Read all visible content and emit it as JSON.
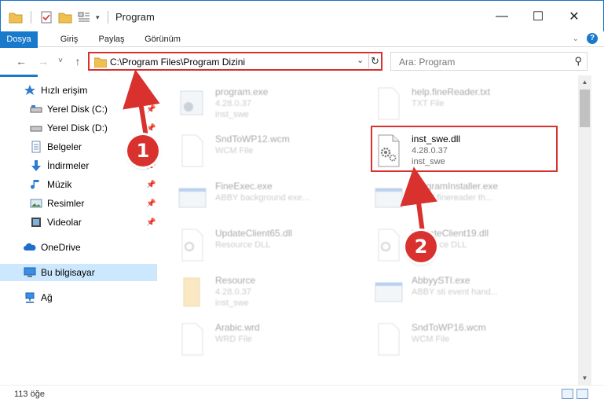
{
  "window": {
    "title": "Program",
    "controls": {
      "minimize": "—",
      "maximize": "☐",
      "close": "✕"
    }
  },
  "ribbon": {
    "tabs": [
      {
        "label": "Dosya"
      },
      {
        "label": "Giriş"
      },
      {
        "label": "Paylaş"
      },
      {
        "label": "Görünüm"
      }
    ],
    "help_label": "?"
  },
  "nav": {
    "back": "←",
    "forward": "→",
    "recent": "˅",
    "up": "↑",
    "address_path": "C:\\Program Files\\Program Dizini",
    "refresh": "↻",
    "search_placeholder": "Ara: Program"
  },
  "sidebar": {
    "items": [
      {
        "label": "Hızlı erişim",
        "icon": "star-icon"
      },
      {
        "label": "Yerel Disk (C:)",
        "icon": "drive-icon",
        "pinned": true
      },
      {
        "label": "Yerel Disk (D:)",
        "icon": "drive-icon",
        "pinned": true
      },
      {
        "label": "Belgeler",
        "icon": "documents-icon",
        "pinned": true
      },
      {
        "label": "İndirmeler",
        "icon": "download-icon",
        "pinned": true
      },
      {
        "label": "Müzik",
        "icon": "music-icon",
        "pinned": true
      },
      {
        "label": "Resimler",
        "icon": "pictures-icon",
        "pinned": true
      },
      {
        "label": "Videolar",
        "icon": "videos-icon",
        "pinned": true
      },
      {
        "label": "OneDrive",
        "icon": "cloud-icon"
      },
      {
        "label": "Bu bilgisayar",
        "icon": "computer-icon",
        "selected": true
      },
      {
        "label": "Ağ",
        "icon": "network-icon"
      }
    ]
  },
  "files": [
    {
      "name": "program.exe",
      "line2": "4.28.0.37",
      "line3": "inst_swe",
      "icon": "exe-icon"
    },
    {
      "name": "help.fineReader.txt",
      "line2": "TXT File",
      "line3": "",
      "icon": "text-file-icon"
    },
    {
      "name": "SndToWP12.wcm",
      "line2": "WCM File",
      "line3": "",
      "icon": "generic-file-icon"
    },
    {
      "name": "inst_swe.dll",
      "line2": "4.28.0.37",
      "line3": "inst_swe",
      "icon": "dll-gear-icon",
      "highlighted": true
    },
    {
      "name": "FineExec.exe",
      "line2": "ABBY background exe...",
      "line3": "",
      "icon": "app-window-icon"
    },
    {
      "name": "ProgramInstaller.exe",
      "line2": "ABBY finereader th...",
      "line3": "",
      "icon": "app-window-icon"
    },
    {
      "name": "UpdateClient65.dll",
      "line2": "Resource DLL",
      "line3": "",
      "icon": "dll-gear-icon"
    },
    {
      "name": "UpdateClient19.dll",
      "line2": "Resource DLL",
      "line3": "",
      "icon": "dll-gear-icon"
    },
    {
      "name": "Resource",
      "line2": "4.28.0.37",
      "line3": "inst_swe",
      "icon": "folder-file-icon"
    },
    {
      "name": "AbbyySTI.exe",
      "line2": "ABBY sti event hand...",
      "line3": "",
      "icon": "app-window-icon"
    },
    {
      "name": "Arabic.wrd",
      "line2": "WRD File",
      "line3": "",
      "icon": "generic-file-icon"
    },
    {
      "name": "SndToWP16.wcm",
      "line2": "WCM File",
      "line3": "",
      "icon": "generic-file-icon"
    }
  ],
  "annotations": {
    "badge1": "1",
    "badge2": "2"
  },
  "status": {
    "item_count": "113 öğe"
  },
  "colors": {
    "accent": "#1979ca",
    "annotation_red": "#d9312e",
    "selected_bg": "#cce8ff"
  }
}
